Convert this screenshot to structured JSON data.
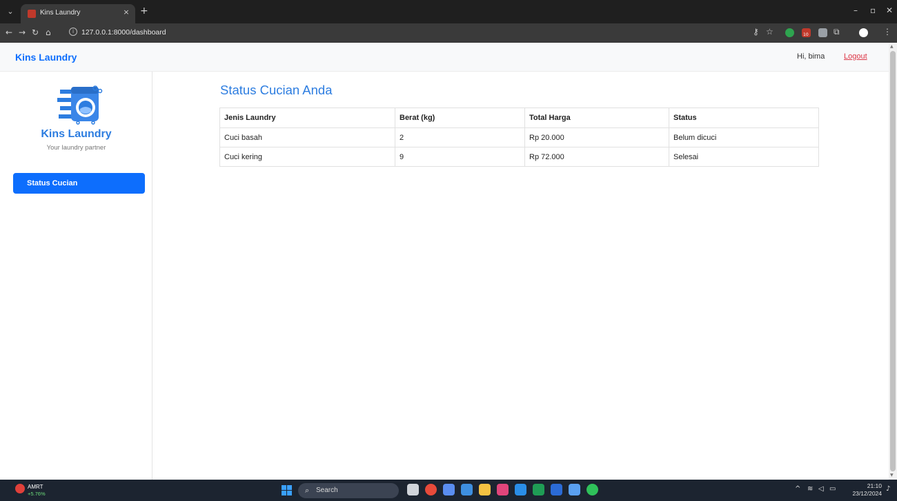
{
  "browser": {
    "tab_title": "Kins Laundry",
    "tab_close": "×",
    "new_tab": "+",
    "url": "127.0.0.1:8000/dashboard",
    "ext_badge": "10"
  },
  "header": {
    "brand": "Kins Laundry",
    "greeting": "Hi, bima",
    "logout": "Logout"
  },
  "sidebar": {
    "title": "Kins Laundry",
    "subtitle": "Your laundry partner",
    "items": [
      {
        "label": "Status Cucian"
      }
    ]
  },
  "main": {
    "title": "Status Cucian Anda",
    "table": {
      "headers": [
        "Jenis Laundry",
        "Berat (kg)",
        "Total Harga",
        "Status"
      ],
      "rows": [
        [
          "Cuci basah",
          "2",
          "Rp 20.000",
          "Belum dicuci"
        ],
        [
          "Cuci kering",
          "9",
          "Rp 72.000",
          "Selesai"
        ]
      ]
    }
  },
  "taskbar": {
    "stock_name": "AMRT",
    "stock_change": "+5.76%",
    "search_placeholder": "Search",
    "time": "21:10",
    "date": "23/12/2024"
  },
  "colors": {
    "accent": "#0d6efd",
    "title_blue": "#2d7de0",
    "logout": "#dc3545"
  }
}
